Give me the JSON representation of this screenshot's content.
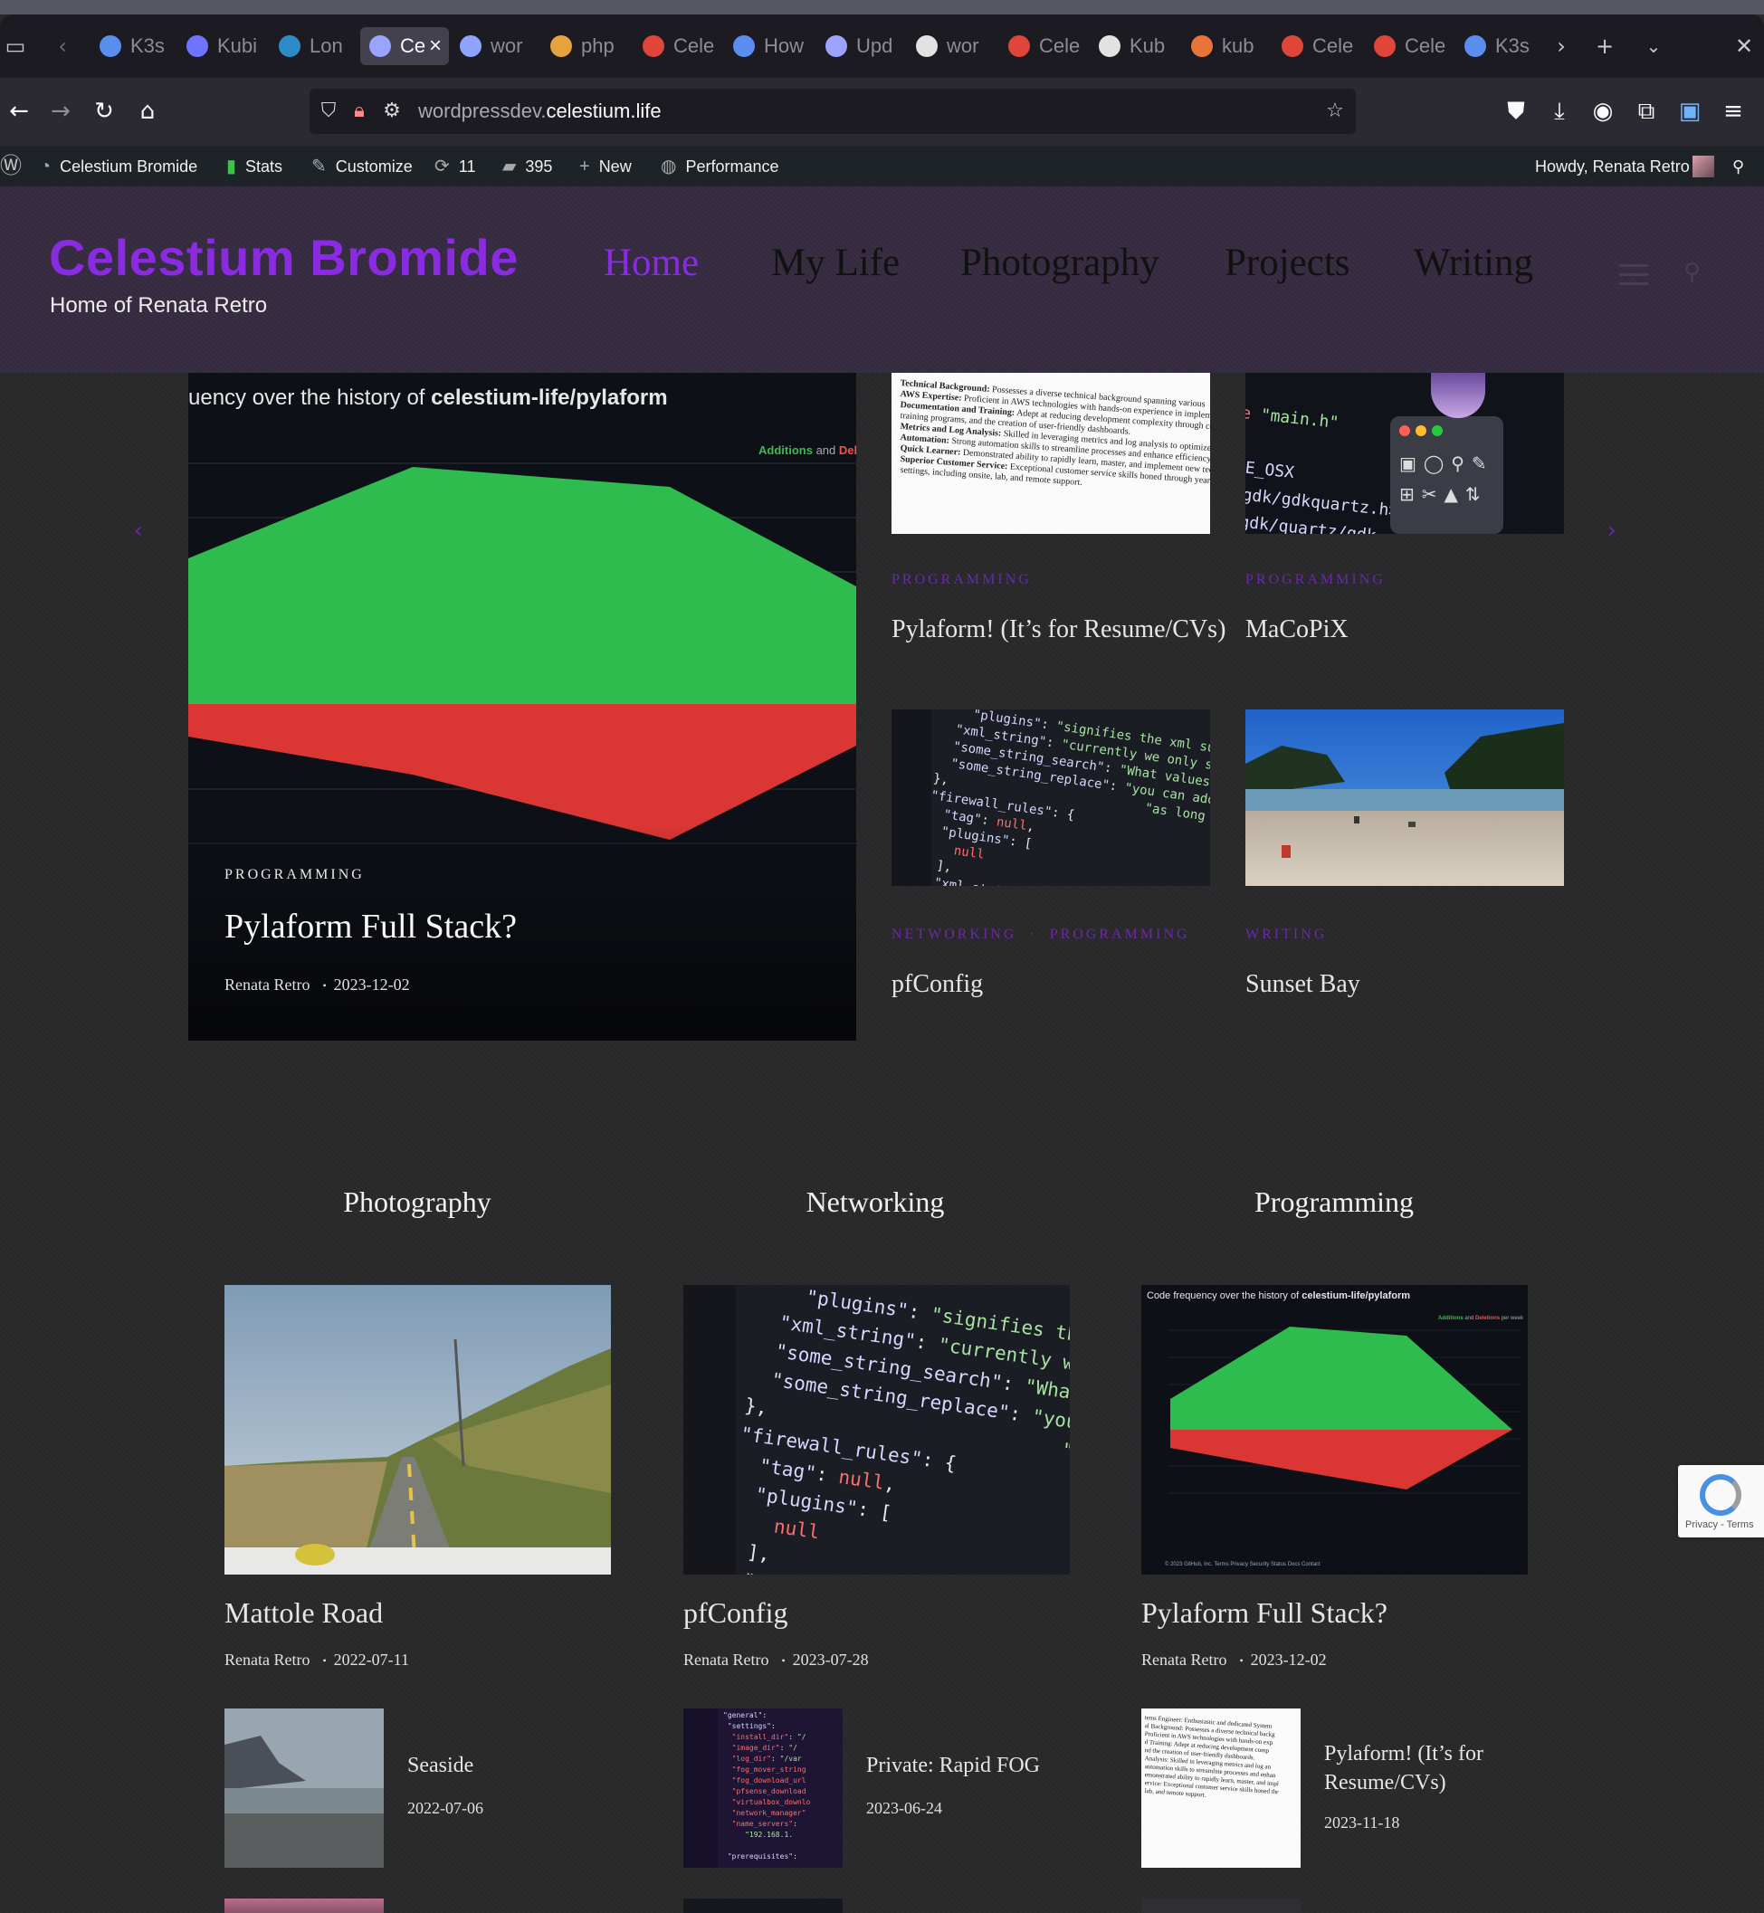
{
  "browser": {
    "tabs": [
      {
        "label": "K3s",
        "color": "#5b8def"
      },
      {
        "label": "Kubi",
        "color": "#6e74ff"
      },
      {
        "label": "Lon",
        "color": "#2d8cc7"
      },
      {
        "label": "Ce",
        "color": "#9aa4ff",
        "active": true
      },
      {
        "label": "wor",
        "color": "#8ea3ff"
      },
      {
        "label": "php",
        "color": "#e6a23c"
      },
      {
        "label": "Cele",
        "color": "#e0453a"
      },
      {
        "label": "How",
        "color": "#5b8def"
      },
      {
        "label": "Upd",
        "color": "#9aa4ff"
      },
      {
        "label": "wor",
        "color": "#e2e2e2"
      },
      {
        "label": "Cele",
        "color": "#e0453a"
      },
      {
        "label": "Kub",
        "color": "#e2e2e2"
      },
      {
        "label": "kub",
        "color": "#e8743a"
      },
      {
        "label": "Cele",
        "color": "#e0453a"
      },
      {
        "label": "Cele",
        "color": "#e0453a"
      },
      {
        "label": "K3s",
        "color": "#5b8def"
      }
    ],
    "url_host_prefix": "wordpressdev.",
    "url_host_domain": "celestium.life"
  },
  "adminbar": {
    "site": "Celestium Bromide",
    "stats": "Stats",
    "customize": "Customize",
    "updates": "11",
    "comments": "395",
    "new": "New",
    "performance": "Performance",
    "howdy": "Howdy, Renata Retro"
  },
  "site": {
    "title": "Celestium Bromide",
    "tagline": "Home of Renata Retro",
    "accent": "#8a2be2"
  },
  "menu": {
    "home": "Home",
    "mylife": "My Life",
    "photography": "Photography",
    "projects": "Projects",
    "writing": "Writing"
  },
  "featured": {
    "main": {
      "thumb_caption": "uency over the history of",
      "thumb_repo": "celestium-life/pylaform",
      "legend_add": "Additions",
      "legend_and": "and",
      "legend_del": "Del",
      "category": "PROGRAMMING",
      "title": "Pylaform Full Stack?",
      "author": "Renata Retro",
      "date": "2023-12-02"
    },
    "grid": [
      {
        "category": "PROGRAMMING",
        "title": "Pylaform! (It’s for Resume/CVs)"
      },
      {
        "category": "PROGRAMMING",
        "title": "MaCoPiX"
      },
      {
        "category": "NETWORKING",
        "category2": "PROGRAMMING",
        "title": "pfConfig"
      },
      {
        "category": "WRITING",
        "title": "Sunset Bay"
      }
    ]
  },
  "sections": {
    "photography": {
      "heading": "Photography",
      "main": {
        "title": "Mattole Road",
        "author": "Renata Retro",
        "date": "2022-07-11"
      },
      "secondary": {
        "title": "Seaside",
        "date": "2022-07-06"
      }
    },
    "networking": {
      "heading": "Networking",
      "main": {
        "title": "pfConfig",
        "author": "Renata Retro",
        "date": "2023-07-28"
      },
      "secondary": {
        "title": "Private: Rapid FOG",
        "date": "2023-06-24"
      }
    },
    "programming": {
      "heading": "Programming",
      "main": {
        "title": "Pylaform Full Stack?",
        "author": "Renata Retro",
        "date": "2023-12-02"
      },
      "secondary": {
        "title_line1": "Pylaform! (It’s for",
        "title_line2": "Resume/CVs)",
        "date": "2023-11-18"
      }
    }
  },
  "chart_thumb": {
    "caption": "Code frequency over the history of",
    "repo": "celestium-life/pylaform",
    "legend_add": "Additions",
    "legend_and": "and",
    "legend_del": "Deletions",
    "legend_tail": "per week",
    "footer": "© 2023 GitHub, Inc.   Terms   Privacy   Security   Status   Docs   Contact"
  },
  "recaptcha": {
    "label": "Privacy - Terms"
  }
}
